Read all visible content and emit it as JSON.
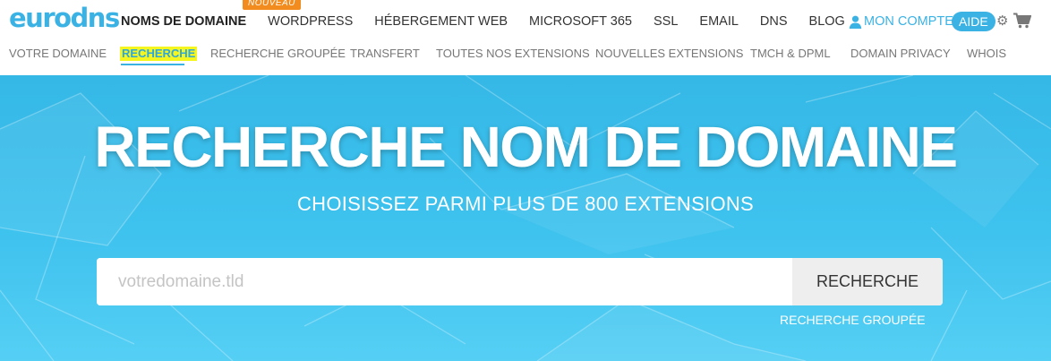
{
  "logo": {
    "text": "eurodns"
  },
  "main_nav": {
    "items": [
      {
        "label": "NOMS DE DOMAINE",
        "active": true
      },
      {
        "label": "WORDPRESS"
      },
      {
        "label": "HÉBERGEMENT WEB"
      },
      {
        "label": "MICROSOFT 365"
      },
      {
        "label": "SSL"
      },
      {
        "label": "EMAIL"
      },
      {
        "label": "DNS"
      },
      {
        "label": "BLOG"
      }
    ],
    "badge": "NOUVEAU"
  },
  "account": {
    "label": "MON COMPTE",
    "icon": "user-icon"
  },
  "help": {
    "label": "AIDE"
  },
  "icons": {
    "settings": "gear-icon",
    "cart": "cart-icon"
  },
  "sub_nav": {
    "items": [
      {
        "label": "VOTRE DOMAINE"
      },
      {
        "label": "RECHERCHE",
        "active": true
      },
      {
        "label": "RECHERCHE GROUPÉE"
      },
      {
        "label": "TRANSFERT"
      },
      {
        "label": "TOUTES NOS EXTENSIONS"
      },
      {
        "label": "NOUVELLES EXTENSIONS"
      },
      {
        "label": "TMCH & DPML"
      },
      {
        "label": "DOMAIN PRIVACY"
      },
      {
        "label": "WHOIS"
      }
    ]
  },
  "hero": {
    "title": "RECHERCHE NOM DE DOMAINE",
    "subtitle": "CHOISISSEZ PARMI PLUS DE 800 EXTENSIONS",
    "search": {
      "placeholder": "votredomaine.tld",
      "value": "",
      "button_label": "RECHERCHE"
    },
    "grouped_link": "RECHERCHE GROUPÉE"
  },
  "colors": {
    "brand": "#3bb2e4",
    "badge": "#f28c1e",
    "highlight": "#f5f520",
    "hero": "#3ec2ee"
  }
}
